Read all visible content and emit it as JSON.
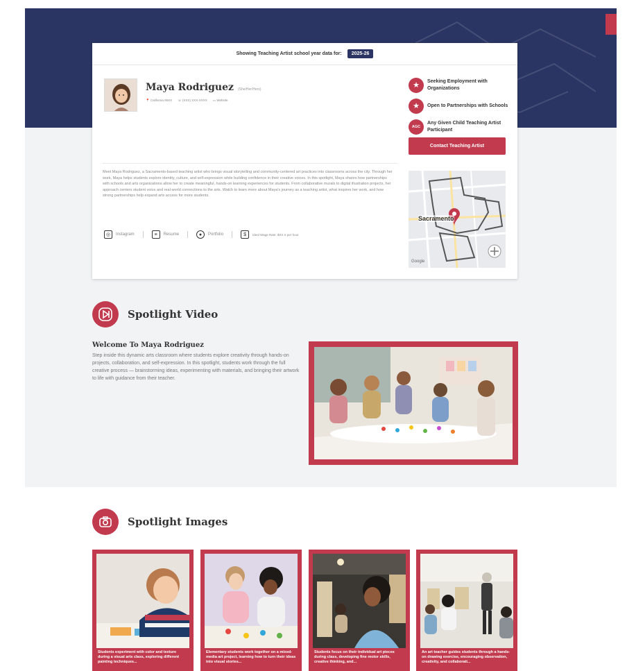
{
  "profile_card": {
    "year_label": "Showing Teaching Artist school year data for:",
    "year_value": "2025-26",
    "name": "Maya Rodriguez",
    "pronouns": "(She/Her/Hers)",
    "location": "California 95XX",
    "phone": "(XXX) XXX-XXXX",
    "website": "Website",
    "badges": [
      {
        "icon": "star-icon",
        "glyph": "★",
        "label": "Seeking Employment with Organizations"
      },
      {
        "icon": "star-icon",
        "glyph": "★",
        "label": "Open to Partnerships with Schools"
      },
      {
        "icon": "agc-icon",
        "glyph": "AGC",
        "label": "Any Given Child Teaching Artist Participant"
      }
    ],
    "contact_button": "Contact Teaching Artist",
    "bio": "Meet Maya Rodriguez, a Sacramento-based teaching artist who brings visual storytelling and community-centered art practices into classrooms across the city. Through her work, Maya helps students explore identity, culture, and self-expression while building confidence in their creative voices. In this spotlight, Maya shares how partnerships with schools and arts organizations allow her to create meaningful, hands-on learning experiences for students. From collaborative murals to digital illustration projects, her approach centers student voice and real-world connections to the arts. Watch to learn more about Maya's journey as a teaching artist, what inspires her work, and how strong partnerships help expand arts access for more students.",
    "links": {
      "instagram": "Instagram",
      "resume": "Resume",
      "portfolio": "Portfolio",
      "rate": "Ideal Wage Rate: $XX.X per hour"
    },
    "map": {
      "city_label": "Sacramento",
      "google_label": "Google"
    }
  },
  "spotlight_video": {
    "section_title": "Spotlight Video",
    "heading": "Welcome To Maya Rodriguez",
    "description": "Step inside this dynamic arts classroom where students explore creativity through hands-on projects, collaboration, and self-expression. In this spotlight, students work through the full creative process — brainstorming ideas, experimenting with materials, and bringing their artwork to life with guidance from their teacher."
  },
  "spotlight_images": {
    "section_title": "Spotlight Images",
    "items": [
      {
        "caption": "Students experiment with color and texture during a visual arts class, exploring different painting techniques..."
      },
      {
        "caption": "Elementary students work together on a mixed-media art project, learning how to turn their ideas into visual stories..."
      },
      {
        "caption": "Students focus on their individual art pieces during class, developing fine motor skills, creative thinking, and..."
      },
      {
        "caption": "An art teacher guides students through a hands-on drawing exercise, encouraging observation, creativity, and collaborati..."
      }
    ]
  },
  "colors": {
    "navy": "#2b3563",
    "accent": "#c23a4e",
    "page_bg": "#f2f3f4"
  }
}
